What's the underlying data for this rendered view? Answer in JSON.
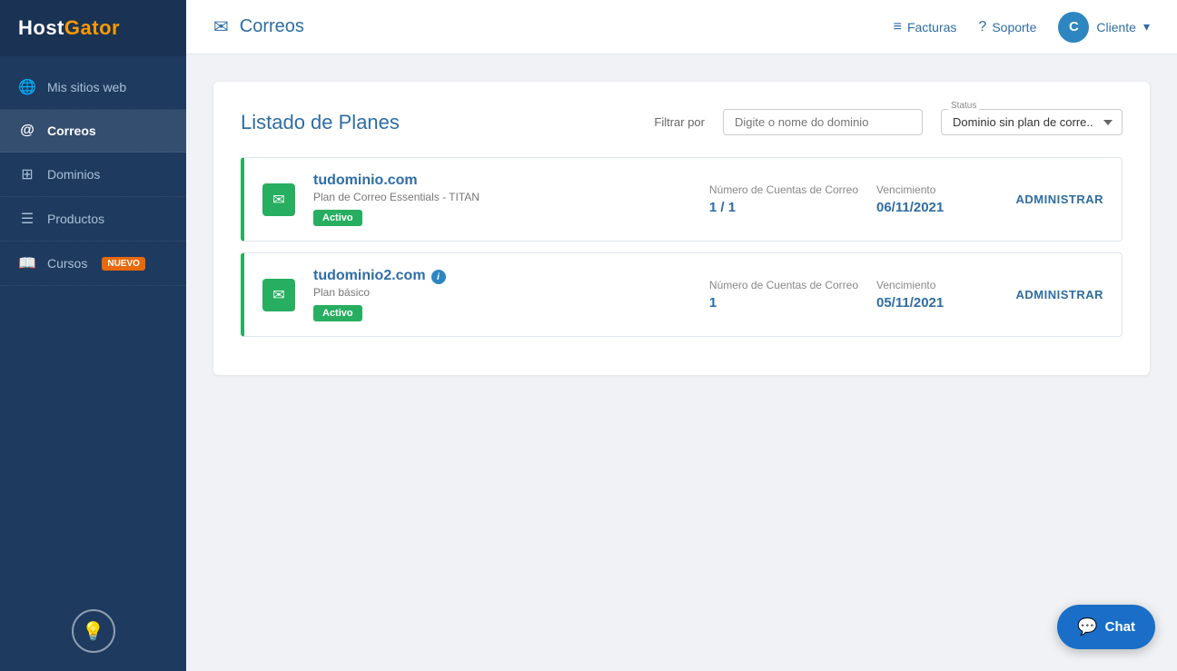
{
  "brand": {
    "name_part1": "Host",
    "name_part2": "Gator"
  },
  "sidebar": {
    "items": [
      {
        "id": "mis-sitios-web",
        "label": "Mis sitios web",
        "icon": "🌐",
        "active": false,
        "badge": null
      },
      {
        "id": "correos",
        "label": "Correos",
        "icon": "@",
        "active": true,
        "badge": null
      },
      {
        "id": "dominios",
        "label": "Dominios",
        "icon": "⊞",
        "active": false,
        "badge": null
      },
      {
        "id": "productos",
        "label": "Productos",
        "icon": "☰",
        "active": false,
        "badge": null
      },
      {
        "id": "cursos",
        "label": "Cursos",
        "icon": "📖",
        "active": false,
        "badge": "NUEVO"
      }
    ]
  },
  "header": {
    "icon": "✉",
    "title": "Correos",
    "facturas_label": "Facturas",
    "soporte_label": "Soporte",
    "user_initial": "C",
    "user_name": "Cliente"
  },
  "plans": {
    "section_title": "Listado de Planes",
    "filter_label": "Filtrar por",
    "filter_placeholder": "Digite o nome do dominio",
    "status_label": "Status",
    "status_option": "Dominio sin plan de corre...",
    "rows": [
      {
        "domain": "tudominio.com",
        "plan_type": "Plan de Correo Essentials - TITAN",
        "badge": "Activo",
        "stat_label": "Número de Cuentas de Correo",
        "stat_value": "1 / 1",
        "venc_label": "Vencimiento",
        "venc_value": "06/11/2021",
        "admin_label": "ADMINISTRAR",
        "show_info": false
      },
      {
        "domain": "tudominio2.com",
        "plan_type": "Plan básico",
        "badge": "Activo",
        "stat_label": "Número de Cuentas de Correo",
        "stat_value": "1",
        "venc_label": "Vencimiento",
        "venc_value": "05/11/2021",
        "admin_label": "ADMINISTRAR",
        "show_info": true
      }
    ]
  },
  "chat": {
    "label": "Chat"
  }
}
